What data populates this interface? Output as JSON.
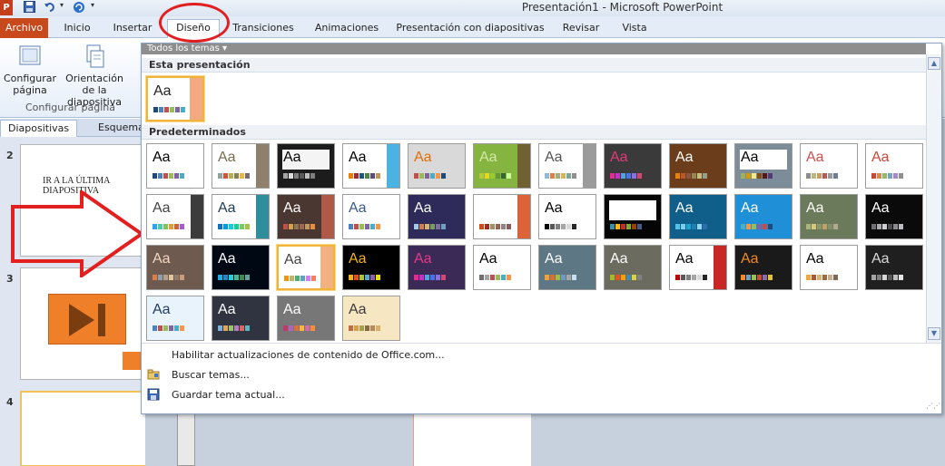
{
  "window": {
    "title": "Presentación1 - Microsoft PowerPoint",
    "app_icon": "P"
  },
  "tabs": [
    {
      "label": "Archivo",
      "name": "tab-archivo"
    },
    {
      "label": "Inicio",
      "name": "tab-inicio"
    },
    {
      "label": "Insertar",
      "name": "tab-insertar"
    },
    {
      "label": "Diseño",
      "name": "tab-diseno"
    },
    {
      "label": "Transiciones",
      "name": "tab-transiciones"
    },
    {
      "label": "Animaciones",
      "name": "tab-animaciones"
    },
    {
      "label": "Presentación con diapositivas",
      "name": "tab-presentacion"
    },
    {
      "label": "Revisar",
      "name": "tab-revisar"
    },
    {
      "label": "Vista",
      "name": "tab-vista"
    }
  ],
  "ribbon": {
    "configurar_label": "Configurar página",
    "orientacion_label": "Orientación de la diapositiva",
    "group_label": "Configurar página"
  },
  "pane": {
    "tab_slides": "Diapositivas",
    "tab_outline": "Esquema",
    "slides": [
      {
        "number": "2",
        "text": "IR A LA ÚLTIMA DIAPOSITIVA"
      },
      {
        "number": "3",
        "text": ""
      },
      {
        "number": "4",
        "text": ""
      }
    ]
  },
  "gallery": {
    "header": "Todos los temas",
    "section_current": "Esta presentación",
    "section_builtin": "Predeterminados",
    "tile_text": "Aa",
    "menu": [
      {
        "label": "Habilitar actualizaciones de contenido de Office.com...",
        "name": "enable-updates-item",
        "icon": ""
      },
      {
        "label": "Buscar temas...",
        "name": "browse-themes-item",
        "icon": "folder-icon"
      },
      {
        "label": "Guardar tema actual...",
        "name": "save-theme-item",
        "icon": "save-icon"
      }
    ],
    "themes": [
      {
        "bg": "#ffffff",
        "fg": "#222222",
        "sw": [
          "#1f497d",
          "#4f81bd",
          "#c0504d",
          "#9bbb59",
          "#8064a2",
          "#4bacc6"
        ],
        "accent": "#f29b6b",
        "selected": true,
        "current": true
      },
      {
        "bg": "#ffffff",
        "fg": "#000000",
        "sw": [
          "#1f497d",
          "#4f81bd",
          "#c0504d",
          "#9bbb59",
          "#8064a2",
          "#4bacc6"
        ]
      },
      {
        "bg": "#ffffff",
        "fg": "#7a6a50",
        "sw": [
          "#93a299",
          "#cf543f",
          "#b5ae53",
          "#848058",
          "#e8b54d",
          "#786c71"
        ],
        "accent": "#7a6a50"
      },
      {
        "bg": "#1c1c1c",
        "fg": "#000000",
        "sw": [
          "#a5a5a5",
          "#dddddd",
          "#808080",
          "#595959",
          "#bfbfbf",
          "#7f7f7f"
        ],
        "inner": "#f4f4f4"
      },
      {
        "bg": "#ffffff",
        "fg": "#000000",
        "sw": [
          "#f07f09",
          "#9f2936",
          "#1b587c",
          "#4e8542",
          "#604878",
          "#c19859"
        ],
        "accent": "#2ca4dc"
      },
      {
        "bg": "#d9d9d9",
        "fg": "#e46c0a",
        "sw": [
          "#c0504d",
          "#9bbb59",
          "#8064a2",
          "#4bacc6",
          "#f79646",
          "#1f497d"
        ]
      },
      {
        "bg": "#86b440",
        "fg": "#d3e9a7",
        "sw": [
          "#b6c93b",
          "#e6d61e",
          "#99cc33",
          "#669933",
          "#336633",
          "#ccff99"
        ],
        "accent": "#6b5230"
      },
      {
        "bg": "#ffffff",
        "fg": "#555555",
        "sw": [
          "#94b6d2",
          "#dd8047",
          "#a5ab81",
          "#d8b25c",
          "#7ba79d",
          "#968c8c"
        ],
        "accent": "#8a8a8a"
      },
      {
        "bg": "#3a3a3a",
        "fg": "#e03a7a",
        "sw": [
          "#e32d91",
          "#c830cc",
          "#4ea6dc",
          "#4775e7",
          "#8971e1",
          "#d54773"
        ]
      },
      {
        "bg": "#6b3d1a",
        "fg": "#ffffff",
        "sw": [
          "#e48312",
          "#bd582c",
          "#865640",
          "#9b8357",
          "#c2bc80",
          "#94a088"
        ]
      },
      {
        "bg": "#7c8c99",
        "fg": "#000000",
        "sw": [
          "#9eb060",
          "#d09a08",
          "#f2ec86",
          "#824f1c",
          "#511818",
          "#553876"
        ],
        "inner": "#ffffff"
      },
      {
        "bg": "#ffffff",
        "fg": "#cc5050",
        "sw": [
          "#8d8d8d",
          "#b7ba7f",
          "#cc9b63",
          "#b05a5a",
          "#999999",
          "#6e7d8f"
        ]
      },
      {
        "bg": "#ffffff",
        "fg": "#c8473a",
        "sw": [
          "#c8473a",
          "#d68a51",
          "#96b86b",
          "#77a5c1",
          "#a688c4",
          "#8f8f8f"
        ]
      },
      {
        "bg": "#ffffff",
        "fg": "#444444",
        "sw": [
          "#2fa3ee",
          "#4bcaad",
          "#86c157",
          "#d99c3f",
          "#ce6633",
          "#a35dd1"
        ],
        "accent": "#1a1a1a"
      },
      {
        "bg": "#ffffff",
        "fg": "#1f3b54",
        "sw": [
          "#0f6fc6",
          "#009dd9",
          "#0bd0d9",
          "#10cf9b",
          "#7cca62",
          "#a5c249"
        ],
        "accent": "#0a7a8a"
      },
      {
        "bg": "#4a3732",
        "fg": "#ffffff",
        "sw": [
          "#c0504d",
          "#d4a04a",
          "#8a7755",
          "#a06451",
          "#bd9a61",
          "#eb8c3f"
        ],
        "accent": "#c0604a"
      },
      {
        "bg": "#ffffff",
        "fg": "#3a5a8a",
        "sw": [
          "#4f81bd",
          "#c0504d",
          "#9bbb59",
          "#8064a2",
          "#4bacc6",
          "#f79646"
        ]
      },
      {
        "bg": "#2e2a5a",
        "fg": "#ffffff",
        "sw": [
          "#a9c8e8",
          "#d47b4f",
          "#d2b66d",
          "#7a9a62",
          "#7b6f9e",
          "#6fa0c2"
        ]
      },
      {
        "bg": "#ffffff",
        "fg": "#ffffff",
        "sw": [
          "#d34817",
          "#9b2d1f",
          "#a28e6a",
          "#956251",
          "#918485",
          "#855d5d"
        ],
        "accent": "#d34817"
      },
      {
        "bg": "#ffffff",
        "fg": "#000000",
        "sw": [
          "#000000",
          "#595959",
          "#808080",
          "#a6a6a6",
          "#d9d9d9",
          "#262626"
        ]
      },
      {
        "bg": "#050505",
        "fg": "#ffffff",
        "sw": [
          "#3891a7",
          "#feb80a",
          "#c32d2e",
          "#84aa33",
          "#964305",
          "#475a8d"
        ],
        "inner": "#ffffff"
      },
      {
        "bg": "#0f5f8a",
        "fg": "#ffffff",
        "sw": [
          "#53c2e9",
          "#7ad0ec",
          "#1aa5d6",
          "#1f7fb3",
          "#8fd5f0",
          "#2d6ea8"
        ]
      },
      {
        "bg": "#1f90d8",
        "fg": "#ffffff",
        "sw": [
          "#4bacc6",
          "#f79646",
          "#9bbb59",
          "#8064a2",
          "#c0504d",
          "#1f497d"
        ]
      },
      {
        "bg": "#6b7a5a",
        "fg": "#ffffff",
        "sw": [
          "#a9b57e",
          "#d6c97a",
          "#8b9a68",
          "#c2a067",
          "#7f8f6c",
          "#b3a88d"
        ]
      },
      {
        "bg": "#0a0a0a",
        "fg": "#ffffff",
        "sw": [
          "#6f6f74",
          "#a8a8ad",
          "#d0d0d4",
          "#4d4d52",
          "#8a8a8f",
          "#bcbcc1"
        ]
      },
      {
        "bg": "#6e5a4f",
        "fg": "#f2d7c4",
        "sw": [
          "#d97f4b",
          "#8aa2b0",
          "#b6a089",
          "#e2c69d",
          "#8d7b6d",
          "#c99c7a"
        ]
      },
      {
        "bg": "#000814",
        "fg": "#ffffff",
        "sw": [
          "#1cade4",
          "#2683c6",
          "#27ced7",
          "#42ba97",
          "#3e8853",
          "#62a39f"
        ]
      },
      {
        "bg": "#ffffff",
        "fg": "#444444",
        "sw": [
          "#f09415",
          "#c1b56b",
          "#4baf73",
          "#5aa6c0",
          "#d17df9",
          "#fa7e5c"
        ],
        "accent": "#f0a36a",
        "selected": true
      },
      {
        "bg": "#000000",
        "fg": "#f3b316",
        "sw": [
          "#f3b316",
          "#e84d1c",
          "#a3c43b",
          "#5ba7c9",
          "#8b5fa8",
          "#e8e000"
        ]
      },
      {
        "bg": "#3a2a55",
        "fg": "#e23a8a",
        "sw": [
          "#e32d91",
          "#c830cc",
          "#4ea6dc",
          "#4775e7",
          "#8971e1",
          "#d54773"
        ]
      },
      {
        "bg": "#ffffff",
        "fg": "#000000",
        "sw": [
          "#6f6f6f",
          "#a5a5a5",
          "#c0504d",
          "#9bbb59",
          "#4bacc6",
          "#f79646"
        ],
        "inner": "#ffffff"
      },
      {
        "bg": "#5d7785",
        "fg": "#ffffff",
        "sw": [
          "#f2a03d",
          "#dd6d31",
          "#a2be3a",
          "#6c9cc4",
          "#a7a7a7",
          "#c6e1f0"
        ]
      },
      {
        "bg": "#6b6b60",
        "fg": "#ffffff",
        "sw": [
          "#a6b727",
          "#df5327",
          "#fe9e00",
          "#418ab3",
          "#d7d447",
          "#818183"
        ]
      },
      {
        "bg": "#ffffff",
        "fg": "#000000",
        "sw": [
          "#c00000",
          "#595959",
          "#808080",
          "#a6a6a6",
          "#d9d9d9",
          "#262626"
        ],
        "accent": "#c00000"
      },
      {
        "bg": "#1a1a1a",
        "fg": "#f18a2a",
        "sw": [
          "#f18a2a",
          "#6aa0c8",
          "#9ac24c",
          "#c64f3b",
          "#8a6aa8",
          "#e2c23a"
        ]
      },
      {
        "bg": "#ffffff",
        "fg": "#000000",
        "sw": [
          "#f2a83c",
          "#a55b3a",
          "#d4b870",
          "#986a45",
          "#c7b08e",
          "#7f6a57"
        ]
      },
      {
        "bg": "#1f1f1f",
        "fg": "#d9d9d9",
        "sw": [
          "#a5a5a5",
          "#7f7f7f",
          "#d9d9d9",
          "#595959",
          "#bfbfbf",
          "#e7e6e6"
        ]
      },
      {
        "bg": "#e9f3fb",
        "fg": "#1f3a5f",
        "sw": [
          "#4f81bd",
          "#c0504d",
          "#9bbb59",
          "#8064a2",
          "#4bacc6",
          "#f79646"
        ]
      },
      {
        "bg": "#2f3440",
        "fg": "#ffffff",
        "sw": [
          "#7fb0d9",
          "#e3a65b",
          "#9bc36b",
          "#b07dbf",
          "#d96565",
          "#58b9c3"
        ]
      },
      {
        "bg": "#777777",
        "fg": "#ffffff",
        "sw": [
          "#b83d68",
          "#ac66bb",
          "#de6c36",
          "#f9b639",
          "#cf6da4",
          "#fa8d3d"
        ]
      },
      {
        "bg": "#f6e6c2",
        "fg": "#3a3a3a",
        "sw": [
          "#c06e45",
          "#d69f4c",
          "#a3a24a",
          "#876b45",
          "#b8885b",
          "#d7b16a"
        ]
      }
    ]
  }
}
